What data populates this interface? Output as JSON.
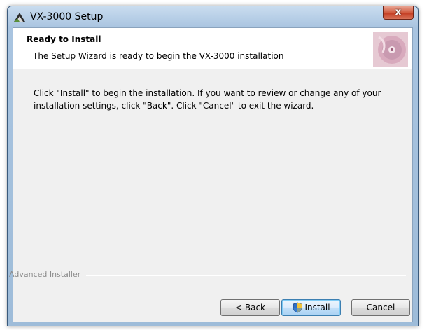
{
  "window": {
    "title": "VX-3000 Setup",
    "close_label": "x"
  },
  "header": {
    "title": "Ready to Install",
    "subtitle": "The Setup Wizard is ready to begin the VX-3000 installation"
  },
  "body": {
    "message": "Click \"Install\" to begin the installation.  If you want to review or change any of your installation settings, click \"Back\".  Click \"Cancel\" to exit the wizard."
  },
  "footer": {
    "brand": "Advanced Installer"
  },
  "buttons": {
    "back": "< Back",
    "install": "Install",
    "cancel": "Cancel"
  },
  "icons": {
    "app": "installer-app-icon",
    "header": "cd-disc-graphic",
    "install": "uac-shield-icon"
  }
}
